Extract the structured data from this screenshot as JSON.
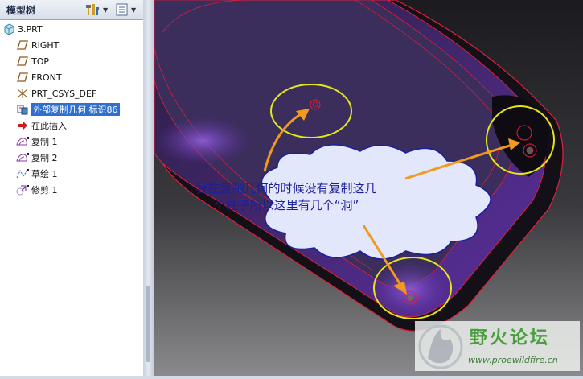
{
  "model_tree": {
    "title": "模型树",
    "items": [
      {
        "label": "3.PRT",
        "icon": "part-icon",
        "level": 0
      },
      {
        "label": "RIGHT",
        "icon": "datum-plane-icon",
        "level": 1
      },
      {
        "label": "TOP",
        "icon": "datum-plane-icon",
        "level": 1
      },
      {
        "label": "FRONT",
        "icon": "datum-plane-icon",
        "level": 1
      },
      {
        "label": "PRT_CSYS_DEF",
        "icon": "coordinate-system-icon",
        "level": 1
      },
      {
        "label": "外部复制几何 标识86",
        "icon": "external-copy-geometry-icon",
        "level": 1,
        "selected": true
      },
      {
        "label": "在此插入",
        "icon": "insert-here-arrow-icon",
        "level": 1
      },
      {
        "label": "复制 1",
        "icon": "copy-surface-icon",
        "level": 1
      },
      {
        "label": "复制 2",
        "icon": "copy-surface-icon",
        "level": 1
      },
      {
        "label": "草绘 1",
        "icon": "sketch-icon",
        "level": 1
      },
      {
        "label": "修剪 1",
        "icon": "trim-icon",
        "level": 1
      }
    ]
  },
  "annotation": {
    "line1": "我在复制几何的时候没有复制这几",
    "line2": "个柱子所以这里有几个“洞”"
  },
  "watermark": {
    "name": "野火论坛",
    "url": "www.proewildfire.cn"
  },
  "colors": {
    "selection": "#2f6fd0",
    "callout_text": "#1a1f9a",
    "highlight_circle": "#e8e61a",
    "arrow": "#f29a1e",
    "model_purple": "#5a2e9e",
    "edge_red": "#e0203a"
  }
}
